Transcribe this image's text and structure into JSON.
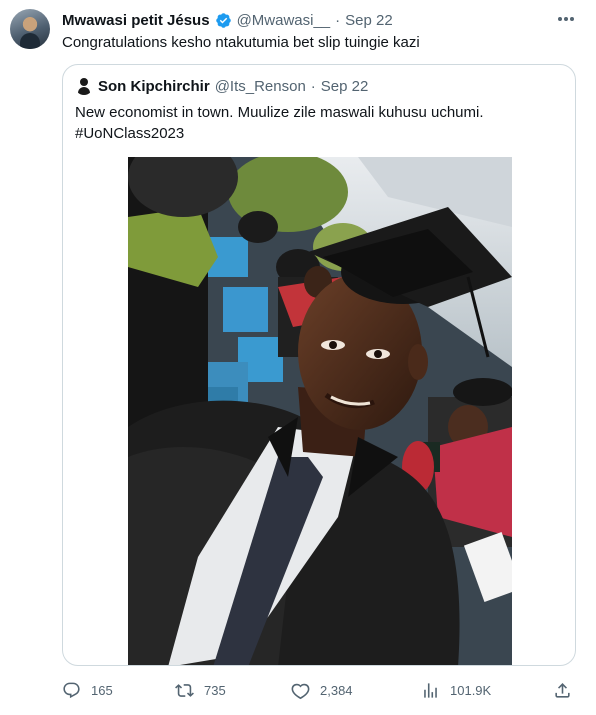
{
  "tweet": {
    "display_name": "Mwawasi petit Jésus",
    "handle": "@Mwawasi__",
    "separator": "·",
    "date": "Sep 22",
    "text": "Congratulations kesho ntakutumia bet slip tuingie kazi"
  },
  "quoted": {
    "display_name": "Son Kipchirchir",
    "handle": "@Its_Renson",
    "separator": "·",
    "date": "Sep 22",
    "text_line1": "New economist in town. Muulize zile maswali kuhusu uchumi.",
    "text_line2": "#UoNClass2023"
  },
  "actions": {
    "replies": "165",
    "retweets": "735",
    "likes": "2,384",
    "views": "101.9K"
  },
  "colors": {
    "text": "#0f1419",
    "muted": "#536471",
    "border": "#cfd9de",
    "verified": "#1d9bf0"
  },
  "icons": [
    "verified-badge-icon",
    "more-icon",
    "reply-icon",
    "retweet-icon",
    "like-icon",
    "views-icon",
    "share-icon"
  ]
}
